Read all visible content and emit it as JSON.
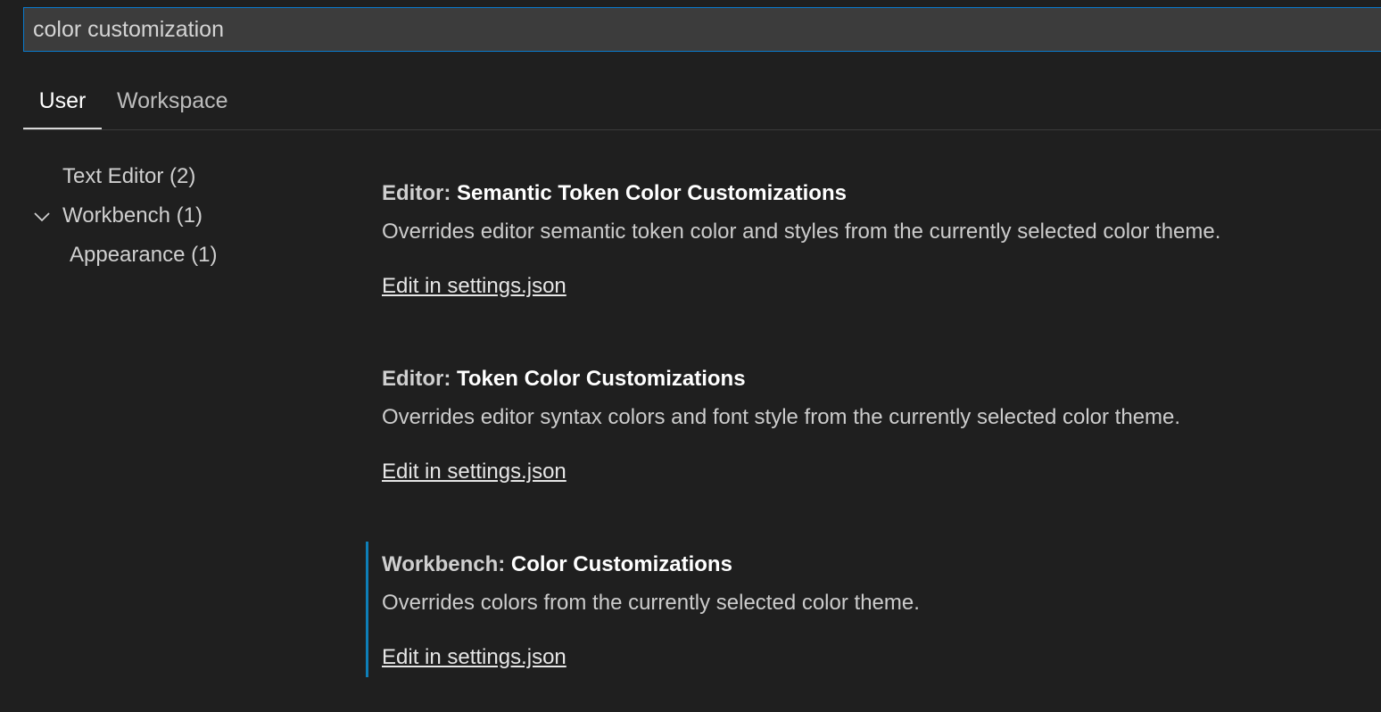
{
  "search": {
    "value": "color customization"
  },
  "tabs": [
    {
      "label": "User",
      "active": true
    },
    {
      "label": "Workspace",
      "active": false
    }
  ],
  "toc": [
    {
      "label": "Text Editor (2)"
    },
    {
      "label": "Workbench (1)",
      "expanded": true
    },
    {
      "label": "Appearance (1)"
    }
  ],
  "settings": [
    {
      "category": "Editor: ",
      "name": "Semantic Token Color Customizations",
      "description": "Overrides editor semantic token color and styles from the currently selected color theme.",
      "link": "Edit in settings.json"
    },
    {
      "category": "Editor: ",
      "name": "Token Color Customizations",
      "description": "Overrides editor syntax colors and font style from the currently selected color theme.",
      "link": "Edit in settings.json"
    },
    {
      "category": "Workbench: ",
      "name": "Color Customizations",
      "description": "Overrides colors from the currently selected color theme.",
      "link": "Edit in settings.json",
      "focused": true
    }
  ],
  "colors": {
    "background": "#1f1f1f",
    "focus_border": "#0a7acc",
    "focus_indicator": "#0e7fb8"
  },
  "icons": {
    "toc_expand": "chevron-down-icon"
  }
}
